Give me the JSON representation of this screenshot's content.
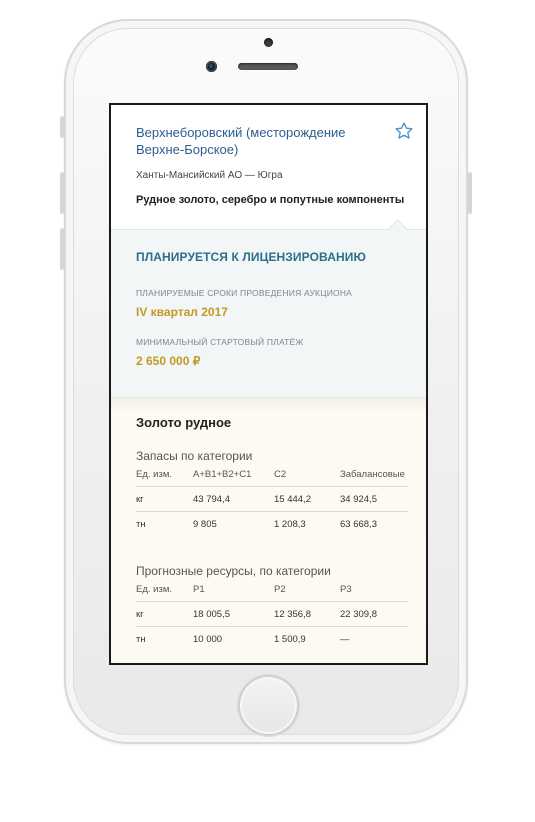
{
  "object": {
    "title": "Верхнеборовский (месторождение Верхне-Борское)",
    "region": "Ханты-Мансийский АО — Югра",
    "minerals": "Рудное золото, серебро и попутные компоненты",
    "favorite_icon": "star-outline-icon"
  },
  "status": {
    "title": "ПЛАНИРУЕТСЯ К ЛИЦЕНЗИРОВАНИЮ",
    "auction_label": "ПЛАНИРУЕМЫЕ СРОКИ ПРОВЕДЕНИЯ АУКЦИОНА",
    "auction_value": "IV квартал 2017",
    "payment_label": "МИНИМАЛЬНЫЙ СТАРТОВЫЙ ПЛАТЁЖ",
    "payment_value": "2 650 000 ₽"
  },
  "resource": {
    "title": "Золото рудное",
    "reserves": {
      "title": "Запасы по категории",
      "headers": [
        "Ед. изм.",
        "A+B1+B2+C1",
        "C2",
        "Забалансовые"
      ],
      "rows": [
        [
          "кг",
          "43 794,4",
          "15 444,2",
          "34 924,5"
        ],
        [
          "тн",
          "9 805",
          "1 208,3",
          "63 668,3"
        ]
      ]
    },
    "forecast": {
      "title": "Прогнозные ресурсы, по категории",
      "headers": [
        "Ед. изм.",
        "P1",
        "P2",
        "P3"
      ],
      "rows": [
        [
          "кг",
          "18 005,5",
          "12 356,8",
          "22 309,8"
        ],
        [
          "тн",
          "10 000",
          "1 500,9",
          "—"
        ]
      ]
    }
  },
  "colors": {
    "link": "#2b5f8f",
    "status": "#2b6f8a",
    "gold": "#c29a22",
    "status_bg": "#f2f6f7",
    "content_bg": "#fdfbf1"
  }
}
